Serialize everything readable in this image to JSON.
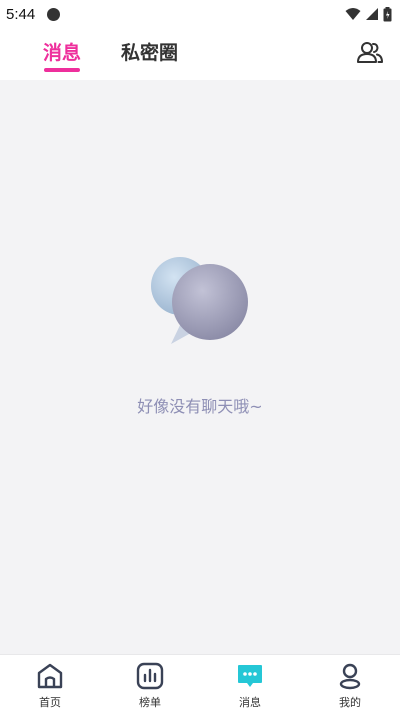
{
  "status_bar": {
    "time": "5:44"
  },
  "header": {
    "tabs": [
      {
        "label": "消息",
        "active": true
      },
      {
        "label": "私密圈",
        "active": false
      }
    ],
    "contacts_icon": "contacts-icon"
  },
  "main": {
    "empty_text": "好像没有聊天哦~"
  },
  "bottom_nav": {
    "items": [
      {
        "label": "首页",
        "icon": "home-icon"
      },
      {
        "label": "榜单",
        "icon": "chart-icon"
      },
      {
        "label": "消息",
        "icon": "message-icon",
        "active": true
      },
      {
        "label": "我的",
        "icon": "profile-icon"
      }
    ]
  },
  "colors": {
    "accent": "#ee2f9c",
    "message_active": "#25c7d6",
    "empty_text": "#8e8fb5",
    "background": "#f3f3f5"
  }
}
